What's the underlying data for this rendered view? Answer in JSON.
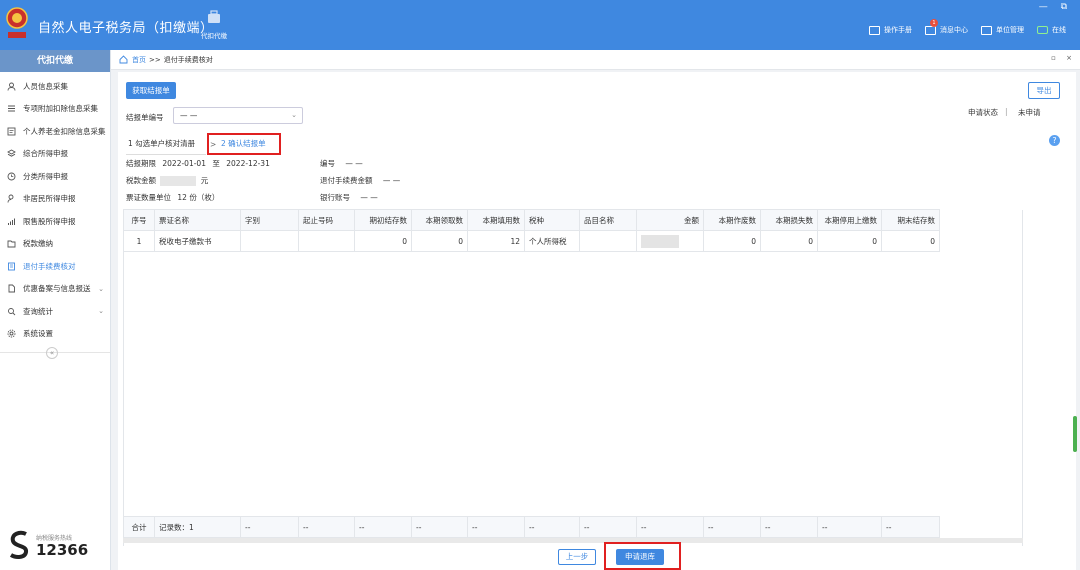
{
  "app": {
    "title": "自然人电子税务局（扣缴端）",
    "emblem_text": "中国税务"
  },
  "toolbar": {
    "tab_label": "代扣代缴"
  },
  "window_controls": {
    "minimize": "—",
    "maximize": "⧉"
  },
  "top_links": [
    {
      "label": "操作手册",
      "icon": "manual-icon"
    },
    {
      "label": "消息中心",
      "icon": "message-icon",
      "badge": "1"
    },
    {
      "label": "单位管理",
      "icon": "building-icon"
    },
    {
      "label": "在线",
      "icon": "online-icon"
    }
  ],
  "sidebar": {
    "header": "代扣代缴",
    "items": [
      {
        "label": "人员信息采集",
        "icon": "person-icon"
      },
      {
        "label": "专项附加扣除信息采集",
        "icon": "list-icon"
      },
      {
        "label": "个人养老金扣除信息采集",
        "icon": "document-icon"
      },
      {
        "label": "综合所得申报",
        "icon": "layers-icon"
      },
      {
        "label": "分类所得申报",
        "icon": "clock-icon"
      },
      {
        "label": "非居民所得申报",
        "icon": "user-icon"
      },
      {
        "label": "限售股所得申报",
        "icon": "bar-chart-icon"
      },
      {
        "label": "税款缴纳",
        "icon": "folder-icon"
      },
      {
        "label": "退付手续费核对",
        "icon": "receipt-icon",
        "active": true
      },
      {
        "label": "优惠备案与信息报送",
        "icon": "file-icon",
        "expandable": true
      },
      {
        "label": "查询统计",
        "icon": "search-chart-icon",
        "expandable": true
      },
      {
        "label": "系统设置",
        "icon": "gear-icon"
      }
    ],
    "collapse_glyph": "«",
    "hotline_label": "纳税服务热线",
    "hotline_number": "12366"
  },
  "breadcrumb": {
    "home": "首页",
    "sep": ">>",
    "current": "退付手续费核对"
  },
  "crumb_controls": "▫ ×",
  "main": {
    "fetch_button": "获取结报单",
    "export_button": "导出",
    "settlement_label": "结报单编号",
    "settlement_value": "— —",
    "status_label": "申请状态",
    "status_sep": "|",
    "status_value": "未申请",
    "help_glyph": "?",
    "steps": [
      {
        "label": "1 勾选单户核对清册"
      },
      {
        "label": "2 确认结报单",
        "active": true
      }
    ],
    "step_arrow": ">",
    "info": {
      "period_label": "结报期限",
      "period_from": "2022-01-01",
      "period_to_word": "至",
      "period_to": "2022-12-31",
      "number_label": "编号",
      "number_value": "— —",
      "tax_amount_label": "税款金额",
      "tax_amount_unit": "元",
      "refund_fee_label": "退付手续费金额",
      "refund_fee_value": "— —",
      "voucher_label": "票证数量单位",
      "voucher_value": "12 份（枚）",
      "bank_label": "银行账号",
      "bank_value": "— —"
    },
    "table": {
      "columns": [
        "序号",
        "票证名称",
        "字别",
        "起止号码",
        "期初结存数",
        "本期领取数",
        "本期填用数",
        "税种",
        "品目名称",
        "金额",
        "本期作废数",
        "本期损失数",
        "本期停用上缴数",
        "期末结存数"
      ],
      "rows": [
        [
          "1",
          "税收电子缴款书",
          "",
          "",
          "0",
          "0",
          "12",
          "个人所得税",
          "",
          "",
          "0",
          "0",
          "0",
          "0"
        ]
      ],
      "total": {
        "label": "合计",
        "count_label": "记录数：1",
        "dash": "--"
      }
    },
    "prev_button": "上一步",
    "submit_button": "申请退库"
  }
}
